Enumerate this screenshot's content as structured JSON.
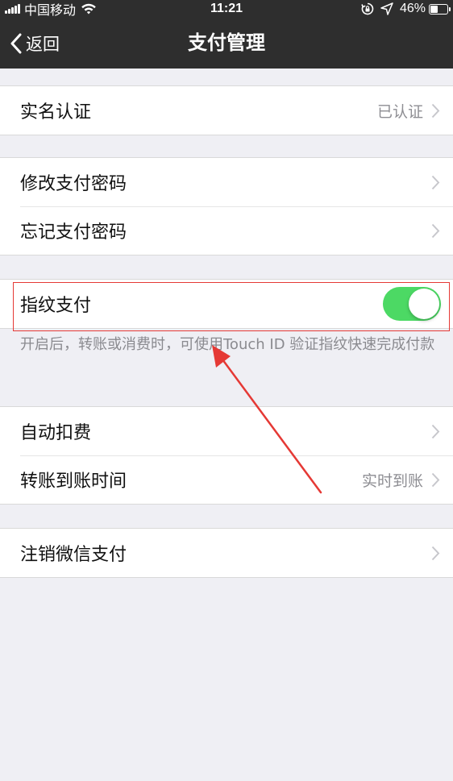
{
  "status_bar": {
    "carrier": "中国移动",
    "time": "11:21",
    "battery_pct": "46%",
    "battery_level": 0.46
  },
  "nav": {
    "back_label": "返回",
    "title": "支付管理"
  },
  "groups": [
    {
      "rows": [
        {
          "label": "实名认证",
          "value": "已认证"
        }
      ]
    },
    {
      "rows": [
        {
          "label": "修改支付密码",
          "value": ""
        },
        {
          "label": "忘记支付密码",
          "value": ""
        }
      ]
    },
    {
      "rows": [
        {
          "label": "指纹支付",
          "toggle": true
        }
      ]
    },
    {
      "rows": [
        {
          "label": "自动扣费",
          "value": ""
        },
        {
          "label": "转账到账时间",
          "value": "实时到账"
        }
      ]
    },
    {
      "rows": [
        {
          "label": "注销微信支付",
          "value": ""
        }
      ]
    }
  ],
  "fingerprint_note": "开启后，转账或消费时，可使用Touch ID 验证指纹快速完成付款",
  "colors": {
    "nav_background": "#2e2e2e",
    "toggle_on": "#4cd964",
    "annotation_red": "#e53935",
    "page_background": "#efeff4"
  }
}
